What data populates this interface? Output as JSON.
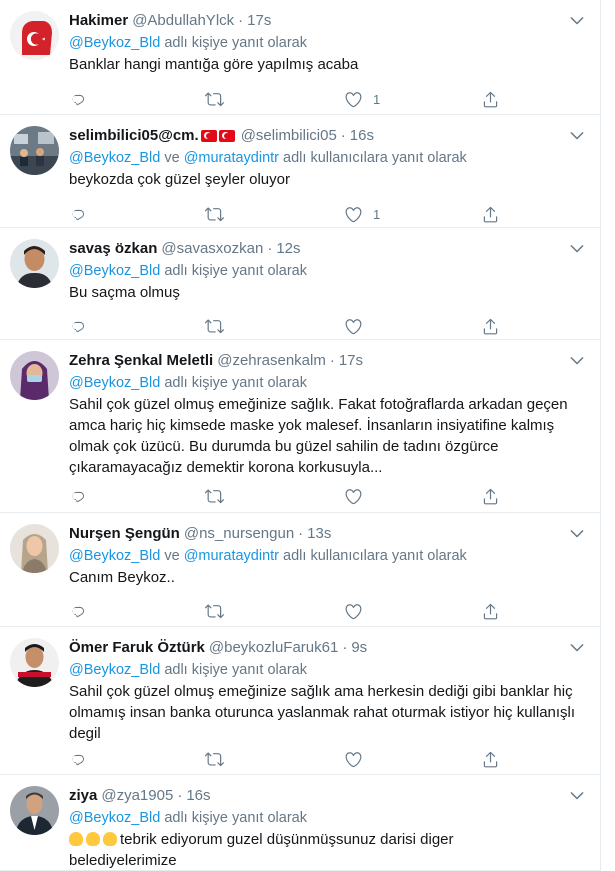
{
  "feed": {
    "tweets": [
      {
        "name": "Hakimer",
        "handle": "@AbdullahYlck",
        "time": "17s",
        "reply_to": [
          "@Beykoz_Bld"
        ],
        "reply_suffix": "adlı kişiye yanıt olarak",
        "lines": [
          "Banklar hangi mantığa göre yapılmış acaba"
        ],
        "likes": "1"
      },
      {
        "name": "selimbilici05@cm.",
        "handle": "@selimbilici05",
        "time": "16s",
        "reply_to": [
          "@Beykoz_Bld",
          "@murataydintr"
        ],
        "reply_join": "ve",
        "reply_suffix": "adlı kullanıcılara yanıt olarak",
        "lines": [
          "beykozda çok güzel şeyler oluyor"
        ],
        "likes": "1"
      },
      {
        "name": "savaş özkan",
        "handle": "@savasxozkan",
        "time": "12s",
        "reply_to": [
          "@Beykoz_Bld"
        ],
        "reply_suffix": "adlı kişiye yanıt olarak",
        "lines": [
          "Bu saçma olmuş"
        ],
        "likes": ""
      },
      {
        "name": "Zehra Şenkal Meletli",
        "handle": "@zehrasenkalm",
        "time": "17s",
        "reply_to": [
          "@Beykoz_Bld"
        ],
        "reply_suffix": "adlı kişiye yanıt olarak",
        "lines": [
          "Sahil çok güzel olmuş emeğinize sağlık. Fakat fotoğraflarda arkadan geçen",
          "amca hariç hiç kimsede maske yok malesef. İnsanların insiyatifine kalmış",
          "olmak çok üzücü.  Bu durumda bu güzel sahilin de tadını özgürce",
          "çıkaramayacağız demektir korona korkusuyla..."
        ],
        "likes": ""
      },
      {
        "name": "Nurşen Şengün",
        "handle": "@ns_nursengun",
        "time": "13s",
        "reply_to": [
          "@Beykoz_Bld",
          "@murataydintr"
        ],
        "reply_join": "ve",
        "reply_suffix": "adlı kullanıcılara yanıt olarak",
        "lines": [
          "Canım Beykoz.."
        ],
        "likes": ""
      },
      {
        "name": "Ömer Faruk Öztürk",
        "handle": "@beykozluFaruk61",
        "time": "9s",
        "reply_to": [
          "@Beykoz_Bld"
        ],
        "reply_suffix": "adlı kişiye yanıt olarak",
        "lines": [
          "Sahil çok güzel olmuş emeğinize sağlık ama herkesin dediği gibi banklar hiç",
          "olmamış insan banka oturunca yaslanmak rahat oturmak istiyor hiç kullanışlı",
          "degil"
        ],
        "likes": ""
      },
      {
        "name": "ziya",
        "handle": "@zya1905",
        "time": "16s",
        "reply_to": [
          "@Beykoz_Bld"
        ],
        "reply_suffix": "adlı kişiye yanıt olarak",
        "lines": [
          "tebrik ediyorum guzel düşünmüşsunuz darisi diger",
          "belediyelerimize"
        ],
        "emoji_lead": 3,
        "likes": ""
      }
    ],
    "separator": "·"
  },
  "icons": {
    "reply": "reply-icon",
    "retweet": "retweet-icon",
    "like": "heart-icon",
    "share": "share-icon",
    "caret": "chevron-down-icon"
  },
  "colors": {
    "link": "#1b95e0",
    "muted": "#657786",
    "text": "#14171a",
    "divider": "#e6ecf0"
  }
}
